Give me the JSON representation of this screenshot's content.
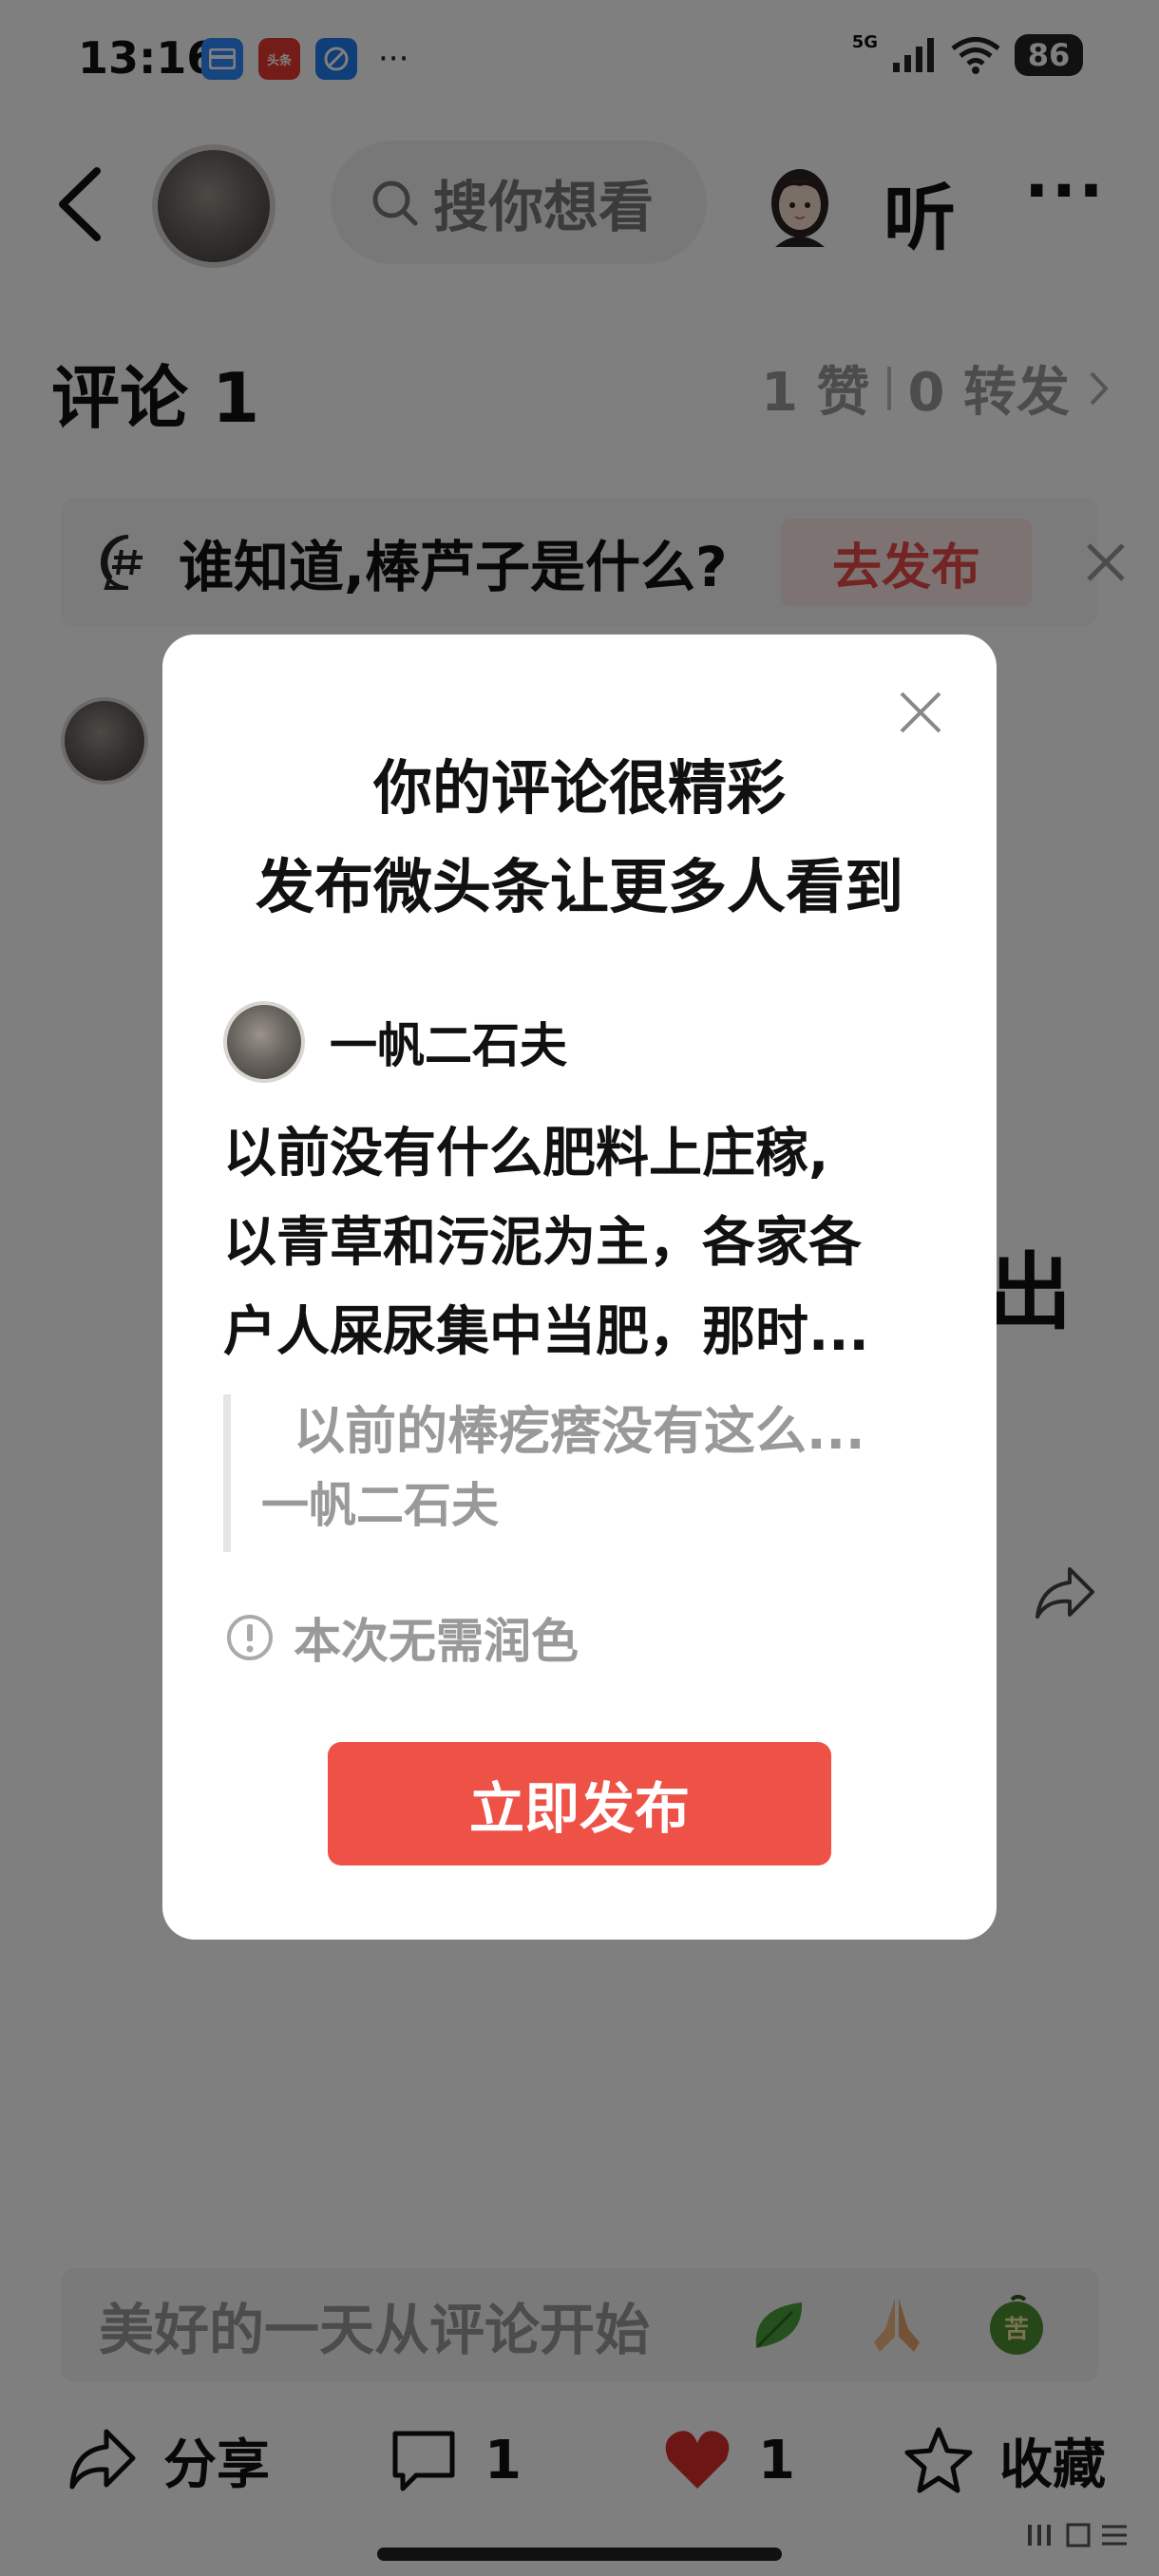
{
  "status_bar": {
    "time": "13:16",
    "notification_toutiao_label": "头条",
    "more": "···",
    "network": "5G",
    "battery": "86"
  },
  "nav": {
    "search_placeholder": "搜你想看",
    "listen_label": "听",
    "menu": "···"
  },
  "comments": {
    "title": "评论 1",
    "likes": "1 赞",
    "reposts": "0 转发"
  },
  "topic_banner": {
    "text": "谁知道,棒芦子是什么?",
    "publish_label": "去发布"
  },
  "background": {
    "partial_char": "出"
  },
  "modal": {
    "title_line1": "你的评论很精彩",
    "title_line2": "发布微头条让更多人看到",
    "username": "一帆二石夫",
    "body_line1": "以前没有什么肥料上庄稼,",
    "body_line2": "以青草和污泥为主，各家各",
    "body_line3": "户人屎尿集中当肥，那时...",
    "quote_text": "以前的棒疙瘩没有这么...",
    "quote_author": "一帆二石夫",
    "polish_note": "本次无需润色",
    "publish_button": "立即发布"
  },
  "bottom": {
    "comment_placeholder": "美好的一天从评论开始",
    "emoji3_label": "苦",
    "share_label": "分享",
    "comment_count": "1",
    "like_count": "1",
    "favorite_label": "收藏"
  },
  "colors": {
    "accent_red": "#ee5247",
    "like_red": "#d92c2c",
    "overlay": "rgba(0,0,0,0.5)"
  }
}
